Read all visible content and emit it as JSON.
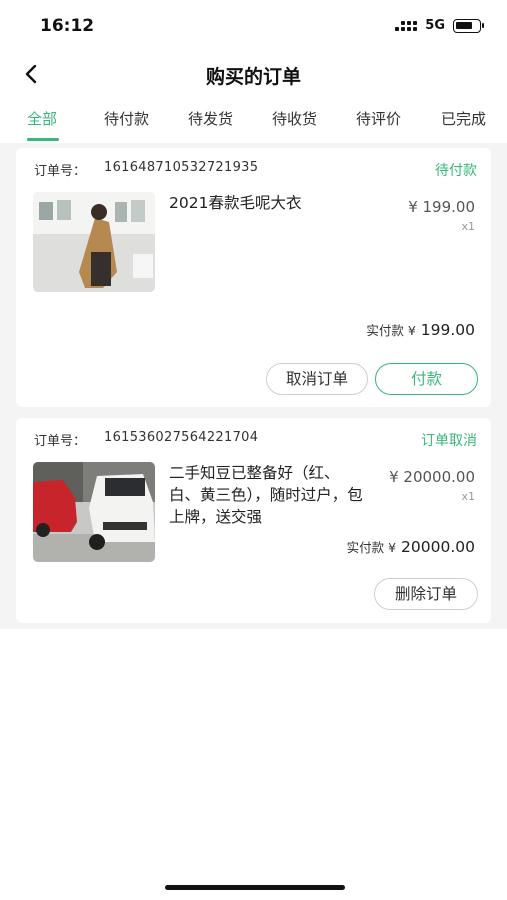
{
  "status_bar": {
    "time": "16:12",
    "network": "5G"
  },
  "nav": {
    "title": "购买的订单"
  },
  "tabs": [
    {
      "label": "全部",
      "active": true
    },
    {
      "label": "待付款"
    },
    {
      "label": "待发货"
    },
    {
      "label": "待收货"
    },
    {
      "label": "待评价"
    },
    {
      "label": "已完成"
    }
  ],
  "orders": [
    {
      "order_no_label": "订单号：",
      "order_no": "161648710532721935",
      "status": "待付款",
      "product_title": "2021春款毛呢大衣",
      "price": "¥ 199.00",
      "qty": "x1",
      "paid_label": "实付款 ¥",
      "paid_amount": " 199.00",
      "buttons": {
        "cancel": "取消订单",
        "pay": "付款"
      }
    },
    {
      "order_no_label": "订单号：",
      "order_no": "161536027564221704",
      "status": "订单取消",
      "product_title": "二手知豆已整备好（红、白、黄三色），随时过户，包上牌，送交强",
      "price": "¥ 20000.00",
      "qty": "x1",
      "paid_label": "实付款 ¥",
      "paid_amount": " 20000.00",
      "buttons": {
        "delete": "删除订单"
      }
    }
  ],
  "colors": {
    "accent": "#39b77a",
    "page_bg": "#f4f4f4"
  },
  "icons": [
    "back-icon",
    "signal-icon",
    "battery-icon"
  ]
}
